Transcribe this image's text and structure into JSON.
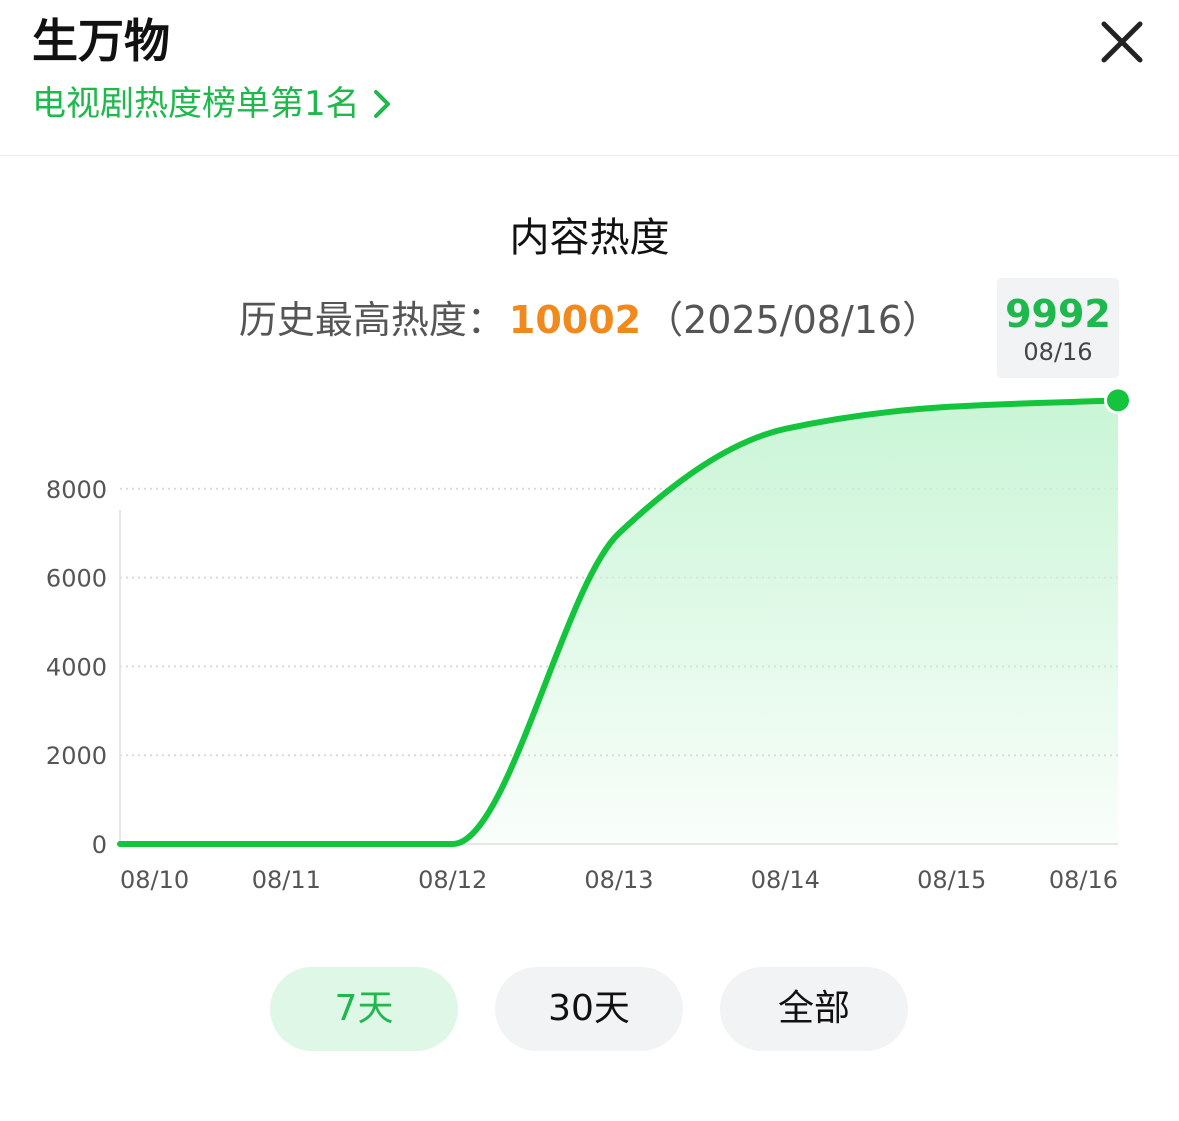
{
  "header": {
    "title": "生万物",
    "rank_text": "电视剧热度榜单第1名"
  },
  "icons": {
    "close": "close-icon",
    "chevron": "chevron-right-icon"
  },
  "section": {
    "title": "内容热度",
    "peak_label": "历史最高热度：",
    "peak_value": "10002",
    "peak_date": "（2025/08/16）"
  },
  "tooltip": {
    "value": "9992",
    "date": "08/16"
  },
  "tabs": [
    {
      "label": "7天",
      "active": true
    },
    {
      "label": "30天",
      "active": false
    },
    {
      "label": "全部",
      "active": false
    }
  ],
  "colors": {
    "accent": "#1fb84c",
    "peak": "#f08a1c",
    "line": "#13c43c",
    "area_top": "#c9f5d6"
  },
  "chart_data": {
    "type": "area",
    "categories": [
      "08/10",
      "08/11",
      "08/12",
      "08/13",
      "08/14",
      "08/15",
      "08/16"
    ],
    "series": [
      {
        "values": [
          0,
          0,
          0,
          7000,
          9350,
          9850,
          9992
        ]
      }
    ],
    "y_ticks": [
      0,
      2000,
      4000,
      6000,
      8000
    ],
    "ylim": [
      0,
      10000
    ],
    "grid": true,
    "highlight_point": {
      "category": "08/16",
      "value": 9992
    },
    "title": "",
    "xlabel": "",
    "ylabel": ""
  }
}
